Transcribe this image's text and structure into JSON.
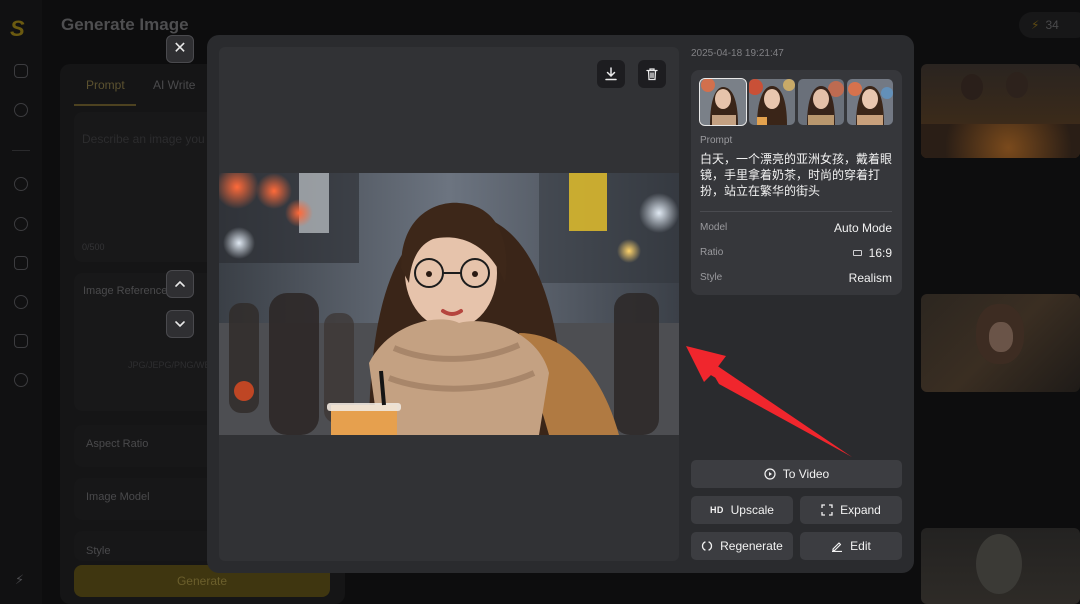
{
  "page": {
    "title": "Generate Image"
  },
  "credits": {
    "count": "34"
  },
  "left_panel": {
    "tabs": [
      {
        "label": "Prompt"
      },
      {
        "label": "AI Write"
      }
    ],
    "prompt_placeholder": "Describe an image you want",
    "char_count": "0/500",
    "image_reference": {
      "label": "Image Reference",
      "formats": "JPG/JEPG/PNG/WEBP"
    },
    "aspect_ratio_label": "Aspect Ratio",
    "image_model_label": "Image Model",
    "style_label": "Style",
    "generate_label": "Generate"
  },
  "modal": {
    "close_label": "✕",
    "timestamp": "2025-04-18 19:21:47",
    "prompt_label": "Prompt",
    "prompt_text": "白天，一个漂亮的亚洲女孩，戴着眼镜，手里拿着奶茶，时尚的穿着打扮，站立在繁华的街头",
    "details": [
      {
        "key": "Model",
        "value": "Auto Mode"
      },
      {
        "key": "Ratio",
        "value": "16:9"
      },
      {
        "key": "Style",
        "value": "Realism"
      }
    ],
    "actions": {
      "to_video": "To Video",
      "hd_badge": "HD",
      "upscale": "Upscale",
      "expand": "Expand",
      "regenerate": "Regenerate",
      "edit": "Edit"
    },
    "thumbnail_count": 4,
    "selected_thumbnail": 1
  },
  "annotation": {
    "arrow_color": "#f0262d"
  },
  "colors": {
    "accent_gold": "#6b5a10",
    "modal_bg": "#2a2b2e"
  }
}
